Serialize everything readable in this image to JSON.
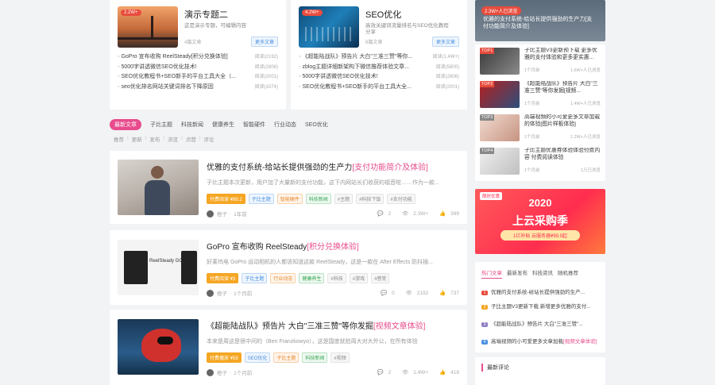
{
  "topics": [
    {
      "badge": "2.2W+",
      "title": "演示专题二",
      "desc": "这是演示专题，可编辑内容",
      "meta": "4篇文章",
      "more": "更多文章",
      "items": [
        {
          "t": "GoPro 宣布收购 ReelSteady[积分兑换体验]",
          "c": "阅读(2192)"
        },
        {
          "t": "5000字讲透微信SEO优化技术!",
          "c": "阅读(2806)"
        },
        {
          "t": "SEO优化教程书+SEO新手的平台工具大全（...",
          "c": "阅读(2001)"
        },
        {
          "t": "seo优化排名网站关键词排名下降原因",
          "c": "阅读(1074)"
        }
      ]
    },
    {
      "badge": "4.2W+",
      "title": "SEO优化",
      "desc": "高效关键词流量排名与SEO优化教程分享",
      "meta": "6篇文章",
      "more": "更多文章",
      "items": [
        {
          "t": "《超能陆战队》预告片 大白\"三准三赞\"等你...",
          "c": "阅读(1.4W+)"
        },
        {
          "t": "zblog主题详细新架构下微信推荐体验文章...",
          "c": "阅读(5800)"
        },
        {
          "t": "5000字讲透微信SEO优化技术!",
          "c": "阅读(2806)"
        },
        {
          "t": "SEO优化教程书+SEO新手的平台工具大全...",
          "c": "阅读(2001)"
        }
      ]
    }
  ],
  "cat_tabs": [
    "最新文章",
    "子比主题",
    "科技新闻",
    "健康养生",
    "智能硬件",
    "行业动态",
    "SEO优化"
  ],
  "sort_tabs": [
    "推荐",
    "更新",
    "发布",
    "浏览",
    "点赞",
    "评论"
  ],
  "posts": [
    {
      "title": "优雅的支付系统-给站长提供强劲的生产力",
      "title_hl": "[支付功能简介及体验]",
      "excerpt": "子比主题本次更新，用户加了大量新的支付功能，这下内网站长们收获的福音啦……作为一款...",
      "tags": [
        "付费阅读 ¥89.2",
        "子比主题",
        "智能硬件",
        "科技新闻",
        "#主题",
        "#科技下饭",
        "#支付功能"
      ],
      "author": "橙子",
      "time": "1年前",
      "stats": [
        "2",
        "2.3W+",
        "399"
      ]
    },
    {
      "title": "GoPro 宣布收购 ReelSteady",
      "title_hl": "[积分兑换体验]",
      "excerpt": "好莱坞电 GoPro 运动相机的人都该知道这款 ReelSteady，这是一款在 After Effects 防抖插...",
      "tags": [
        "付费阅读 ¥3",
        "子比主题",
        "行业动态",
        "健康养生",
        "#科技",
        "#游戏",
        "#感受"
      ],
      "author": "橙子",
      "time": "1个月前",
      "stats": [
        "0",
        "2192",
        "737"
      ]
    },
    {
      "title": "《超能陆战队》预告片 大白\"三准三赞\"等你发掘",
      "title_hl": "[视频文章体验]",
      "excerpt": "本来是周这是很中间的（Ben Franzkowyo），这是国度就拍周大对大外公，在所有体验",
      "tags": [
        "付费播放 ¥59",
        "SEO优化",
        "子比主题",
        "科技新闻",
        "#视频"
      ],
      "author": "橙子",
      "time": "1个月前",
      "stats": [
        "2",
        "1.4W+",
        "418"
      ]
    }
  ],
  "sidebar": {
    "top_badge": "2.3W+人已浏览",
    "top_caption": "优雅的支付系统-给站长提供强劲的生产力[支付功能简介及体验]",
    "hot": [
      {
        "tag": "TOP1",
        "text": "子比主题V3更新预下载 更多优雅的支付体验和更多更实惠...",
        "time": "1个月前",
        "views": "1.6W+人已浏览"
      },
      {
        "tag": "TOP2",
        "text": "《超能陆战队》预告片 大白\"三准三赞\"等你发掘[视频...",
        "time": "1个月前",
        "views": "1.4W+人已浏览"
      },
      {
        "tag": "TOP3",
        "text": "高端视频的小可爱更多文章加载的体验[图片样板体验]",
        "time": "1个月前",
        "views": "1.2W+人已浏览"
      },
      {
        "tag": "TOP4",
        "text": "子比主题优惠券体验体验付费内容 付费阅读体验",
        "time": "1个月前",
        "views": "1万已浏览"
      }
    ],
    "ad": {
      "tag": "限时优惠",
      "year": "2020",
      "main": "上云采购季",
      "sub": "1亿补贴 云服务器¥99.9起"
    },
    "recent_tabs": [
      "热门文章",
      "最新发布",
      "科技资讯",
      "随机推荐"
    ],
    "recent": [
      {
        "n": "1",
        "color": "#e84c3d",
        "text": "优雅的支付系统-给站长提供强劲的生产..."
      },
      {
        "n": "2",
        "color": "#f5a623",
        "text": "子比主题V3更新下载 新增更多优雅的支付..."
      },
      {
        "n": "3",
        "color": "#8e7cc3",
        "text": "《超能陆战队》预告片 大白\"三准三赞\"..."
      },
      {
        "n": "4",
        "color": "#4a90e2",
        "text": "高端视频的小可爱更多文章加载",
        "hl": "[视频文章体验]"
      }
    ],
    "comments_head": "最新评论"
  }
}
